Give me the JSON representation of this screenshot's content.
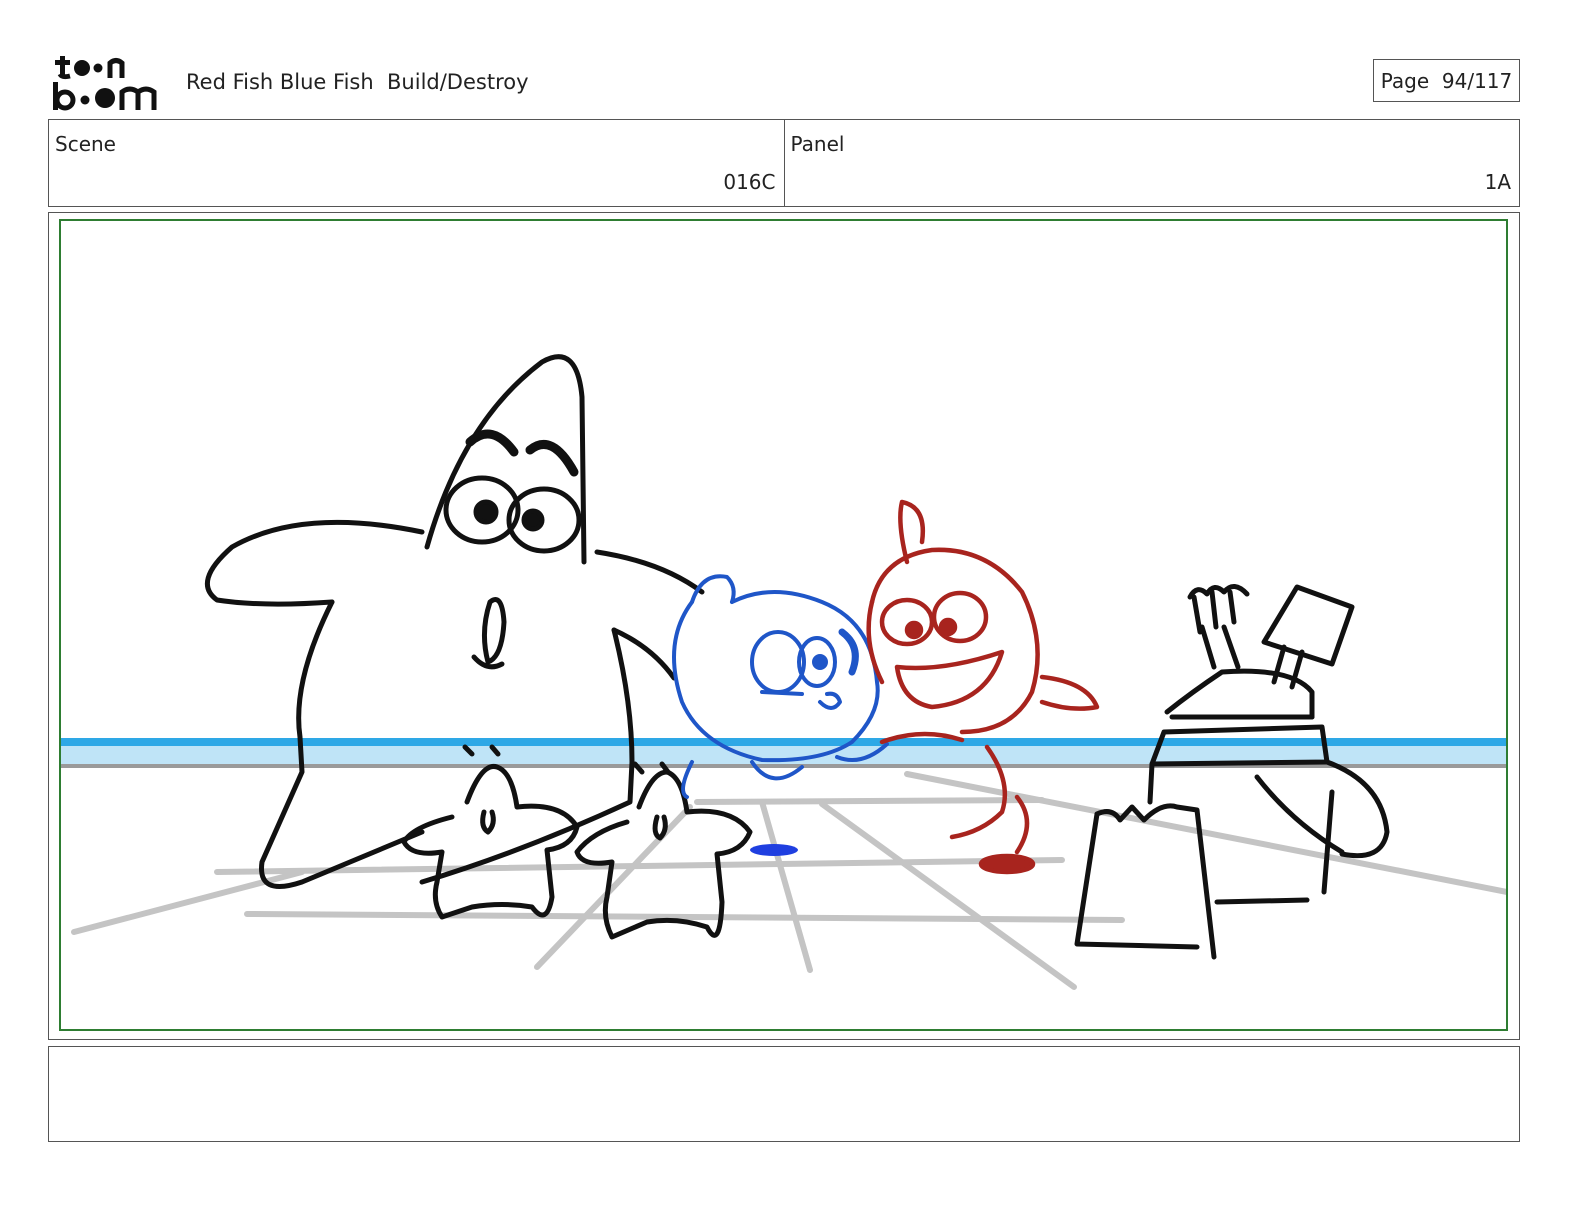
{
  "header": {
    "logo_text": "toon boom",
    "project_title": "Red Fish Blue Fish  Build/Destroy",
    "page_label": "Page  94/117"
  },
  "info": {
    "scene_label": "Scene",
    "scene_value": "016C",
    "panel_label": "Panel",
    "panel_value": "1A"
  },
  "colors": {
    "frame_border": "#2e7d32",
    "blue_fish": "#1f56c8",
    "red_fish": "#a8241e",
    "water_stripe": "#2ea8e6",
    "floor_lines": "#c4c4c4"
  },
  "notes": {
    "text": ""
  }
}
